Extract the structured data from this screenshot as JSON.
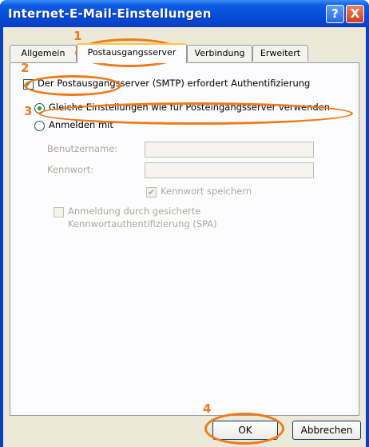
{
  "window": {
    "title": "Internet-E-Mail-Einstellungen",
    "help_label": "?",
    "close_label": "X"
  },
  "tabs": [
    {
      "label": "Allgemein",
      "active": false
    },
    {
      "label": "Postausgangsserver",
      "active": true
    },
    {
      "label": "Verbindung",
      "active": false
    },
    {
      "label": "Erweitert",
      "active": false
    }
  ],
  "outgoing": {
    "auth_required_label": "Der Postausgangsserver (SMTP) erfordert Authentifizierung",
    "auth_required_checked": true,
    "same_settings_label": "Gleiche Einstellungen wie für Posteingangsserver verwenden",
    "same_settings_selected": true,
    "login_with_label": "Anmelden mit",
    "login_with_selected": false,
    "username_label": "Benutzername:",
    "username_value": "",
    "password_label": "Kennwort:",
    "password_value": "",
    "save_password_label": "Kennwort speichern",
    "save_password_checked": true,
    "spa_label_line1": "Anmeldung durch gesicherte",
    "spa_label_line2": "Kennwortauthentifizierung (SPA)",
    "spa_checked": false
  },
  "buttons": {
    "ok_label": "OK",
    "cancel_label": "Abbrechen"
  },
  "annotations": {
    "n1": "1",
    "n2": "2",
    "n3": "3",
    "n4": "4",
    "color": "#f07a1a"
  },
  "colors": {
    "titlebar": "#0548d6",
    "dialog_bg": "#ece9d8",
    "checkmark": "#21a121",
    "disabled_text": "#aca899"
  },
  "icons": {
    "help": "help-icon",
    "close": "close-icon",
    "checkmark": "checkmark-icon"
  }
}
